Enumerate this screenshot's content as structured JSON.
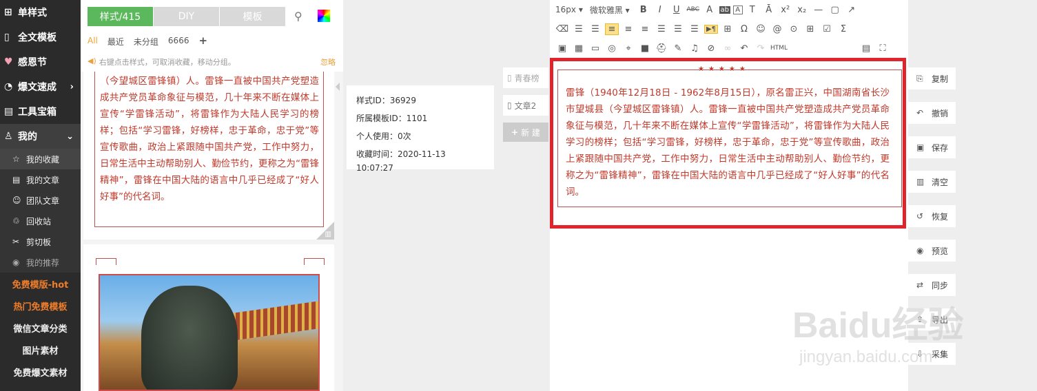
{
  "sidebar": {
    "items": [
      {
        "icon": "grid-icon",
        "glyph": "⊞",
        "label": "单样式"
      },
      {
        "icon": "template-icon",
        "glyph": "▯",
        "label": "全文模板"
      },
      {
        "icon": "heart-icon",
        "glyph": "♥",
        "label": "感恩节"
      },
      {
        "icon": "speed-icon",
        "glyph": "◔",
        "label": "爆文速成"
      },
      {
        "icon": "toolbox-icon",
        "glyph": "▤",
        "label": "工具宝箱"
      },
      {
        "icon": "user-icon",
        "glyph": "♙",
        "label": "我的"
      }
    ],
    "sub_items": [
      {
        "icon": "star-icon",
        "glyph": "☆",
        "label": "我的收藏"
      },
      {
        "icon": "document-icon",
        "glyph": "▤",
        "label": "我的文章"
      },
      {
        "icon": "team-icon",
        "glyph": "☺",
        "label": "团队文章"
      },
      {
        "icon": "recycle-icon",
        "glyph": "♲",
        "label": "回收站"
      },
      {
        "icon": "scissors-icon",
        "glyph": "✂",
        "label": "剪切板"
      },
      {
        "icon": "eye-icon",
        "glyph": "◉",
        "label": "我的推荐"
      }
    ],
    "promos": [
      "免费模版-hot",
      "热门免费模板",
      "微信文章分类",
      "图片素材",
      "免费爆文素材"
    ]
  },
  "panel": {
    "tabs": [
      "样式/415",
      "DIY",
      "模板"
    ],
    "filters": [
      "All",
      "最近",
      "未分组",
      "6666"
    ],
    "hint": "右键点击样式，可取消收藏，移动分组。",
    "hint_action": "忽略",
    "card_text": "（今望城区雷锋镇）人。雷锋一直被中国共产党塑造成共产党员革命象征与模范，几十年来不断在媒体上宣传“学雷锋活动”，将雷锋作为大陆人民学习的榜样；包括“学习雷锋，好榜样，忠于革命，忠于党”等宣传歌曲，政治上紧跟随中国共产党，工作中努力，日常生活中主动帮助别人、勤俭节约，更称之为“雷锋精神”，雷锋在中国大陆的语言中几乎已经成了“好人好事”的代名词。"
  },
  "tooltip": {
    "style_id": "样式ID：36929",
    "template_id": "所属模板ID：1101",
    "personal_use": "个人使用：0次",
    "fav_time": "收藏时间：2020-11-13 10:07:27"
  },
  "doclist": {
    "docs": [
      "青春榜",
      "文章2"
    ],
    "new_label": "新 建"
  },
  "toolbar": {
    "font_size": "16px",
    "font_family": "微软雅黑",
    "row1": [
      "B",
      "I",
      "U",
      "ABC",
      "A",
      "ab",
      "A",
      "T",
      "Ā",
      "x²",
      "x₂",
      "—",
      "▢",
      "↗"
    ],
    "row2": [
      "⌫",
      "☰",
      "☰",
      "≡",
      "≡",
      "≡",
      "☰",
      "☰",
      "☰",
      "▶¶",
      "⊞",
      "Ω",
      "☺",
      "@",
      "⊙",
      "⊞",
      "☑",
      "Σ"
    ],
    "row3": [
      "▣",
      "▦",
      "▭",
      "◎",
      "⌖",
      "■",
      "⛑",
      "✎",
      "♫",
      "⊘",
      "∞",
      "↶",
      "↷",
      "HTML",
      "▤",
      "⛶"
    ]
  },
  "editor": {
    "stars": "★★★★★",
    "content": "雷锋（1940年12月18日 - 1962年8月15日），原名雷正兴，中国湖南省长沙市望城县（今望城区雷锋镇）人。雷锋一直被中国共产党塑造成共产党员革命象征与模范，几十年来不断在媒体上宣传“学雷锋活动”，将雷锋作为大陆人民学习的榜样；包括“学习雷锋，好榜样，忠于革命，忠于党”等宣传歌曲，政治上紧跟随中国共产党，工作中努力，日常生活中主动帮助别人、勤俭节约，更称之为“雷锋精神”，雷锋在中国大陆的语言中几乎已经成了“好人好事”的代名词。"
  },
  "actions": [
    {
      "icon": "copy-icon",
      "glyph": "⎘",
      "label": "复制"
    },
    {
      "icon": "undo-icon",
      "glyph": "↶",
      "label": "撤销"
    },
    {
      "icon": "save-icon",
      "glyph": "▣",
      "label": "保存"
    },
    {
      "icon": "trash-icon",
      "glyph": "▥",
      "label": "清空"
    },
    {
      "icon": "restore-icon",
      "glyph": "↺",
      "label": "恢复"
    },
    {
      "icon": "preview-icon",
      "glyph": "◉",
      "label": "预览"
    },
    {
      "icon": "sync-icon",
      "glyph": "⇄",
      "label": "同步"
    },
    {
      "icon": "export-icon",
      "glyph": "⇪",
      "label": "导出"
    },
    {
      "icon": "collect-icon",
      "glyph": "⇩",
      "label": "采集"
    }
  ],
  "watermark": {
    "brand": "Baidu经验",
    "url": "jingyan.baidu.com"
  },
  "colors": {
    "accent_green": "#5cb85c",
    "content_red": "#c0392b",
    "highlight_border": "#e0242c",
    "sidebar_bg": "#2b2b2b",
    "hot_orange": "#f07d2a"
  }
}
